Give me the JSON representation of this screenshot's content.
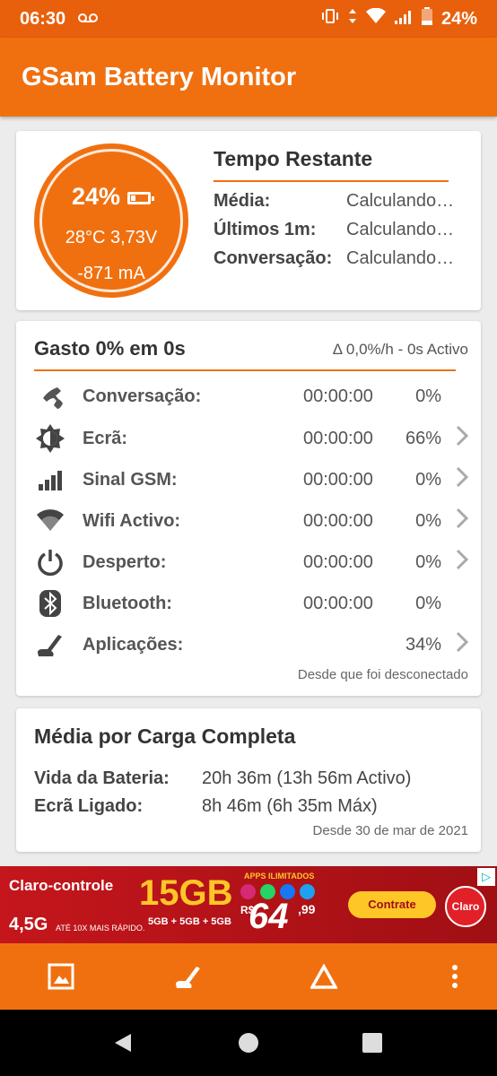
{
  "status_bar": {
    "time": "06:30",
    "battery_pct": "24%"
  },
  "app_bar": {
    "title": "GSam Battery Monitor"
  },
  "gauge": {
    "level": "24%",
    "level_value": 0.24,
    "temp_volt": "28°C  3,73V",
    "current": "-871 mA"
  },
  "tempo_restante": {
    "title": "Tempo Restante",
    "rows": [
      {
        "label": "Média:",
        "value": "Calculando…"
      },
      {
        "label": "Últimos 1m:",
        "value": "Calculando…"
      },
      {
        "label": "Conversação:",
        "value": "Calculando…"
      }
    ]
  },
  "gasto": {
    "title": "Gasto 0% em 0s",
    "rate": "Δ 0,0%/h - 0s Activo",
    "rows": [
      {
        "icon": "phone-icon",
        "name": "Conversação:",
        "time": "00:00:00",
        "pct": "0%",
        "chevron": false
      },
      {
        "icon": "screen-brightness-icon",
        "name": "Ecrã:",
        "time": "00:00:00",
        "pct": "66%",
        "chevron": true
      },
      {
        "icon": "signal-bars-icon",
        "name": "Sinal GSM:",
        "time": "00:00:00",
        "pct": "0%",
        "chevron": true
      },
      {
        "icon": "wifi-icon",
        "name": "Wifi Activo:",
        "time": "00:00:00",
        "pct": "0%",
        "chevron": true
      },
      {
        "icon": "power-icon",
        "name": "Desperto:",
        "time": "00:00:00",
        "pct": "0%",
        "chevron": true
      },
      {
        "icon": "bluetooth-icon",
        "name": "Bluetooth:",
        "time": "00:00:00",
        "pct": "0%",
        "chevron": false
      },
      {
        "icon": "apps-gauge-icon",
        "name": "Aplicações:",
        "time": "",
        "pct": "34%",
        "chevron": true
      }
    ],
    "since": "Desde que foi desconectado"
  },
  "media": {
    "title": "Média por Carga Completa",
    "rows": [
      {
        "label": "Vida da Bateria:",
        "value": "20h 36m (13h 56m Activo)"
      },
      {
        "label": "Ecrã Ligado:",
        "value": "8h 46m (6h 35m Máx)"
      }
    ],
    "since": "Desde 30 de mar de 2021"
  },
  "ad": {
    "brand": "Claro-controle",
    "fourg": "4,5G",
    "fourg_sub": "ATÉ 10X MAIS RÁPIDO.",
    "gb": "15GB",
    "gb_sub": "5GB + 5GB + 5GB",
    "apps_label": "APPS ILIMITADOS",
    "currency": "R$",
    "price": "64",
    "cents": ",99",
    "button": "Contrate",
    "logo": "Claro"
  },
  "colors": {
    "primary": "#f07010",
    "status_bar": "#e8600c",
    "accent_line": "#f07010"
  }
}
